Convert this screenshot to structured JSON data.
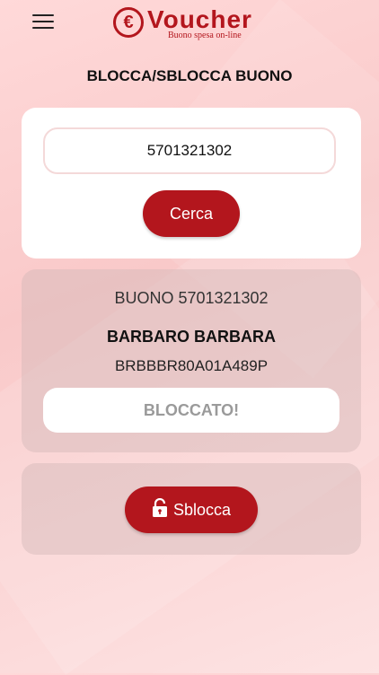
{
  "header": {
    "logo_symbol": "€",
    "logo_text": "Voucher",
    "logo_subtitle": "Buono spesa on-line",
    "brand_color": "#b3161d"
  },
  "page_title": "BLOCCA/SBLOCCA BUONO",
  "search": {
    "value": "5701321302",
    "button_label": "Cerca"
  },
  "result": {
    "voucher_label": "BUONO 5701321302",
    "holder_name": "BARBARO BARBARA",
    "tax_code": "BRBBBR80A01A489P",
    "status": "BLOCCATO!"
  },
  "action": {
    "button_label": "Sblocca",
    "icon": "lock-icon"
  }
}
